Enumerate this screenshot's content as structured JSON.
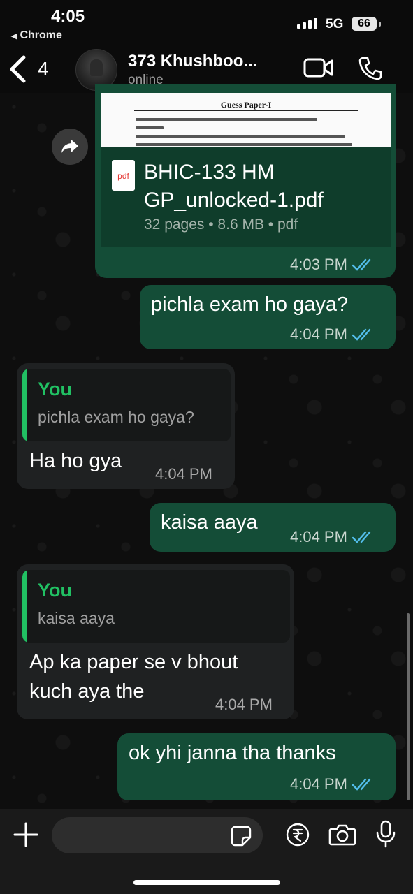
{
  "status_bar": {
    "time": "4:05",
    "back_app": "Chrome",
    "network": "5G",
    "battery": "66"
  },
  "header": {
    "back_count": "4",
    "contact_name": "373 Khushboo...",
    "contact_status": "online"
  },
  "messages": [
    {
      "type": "document",
      "direction": "outgoing",
      "preview_title": "Guess Paper-I",
      "file_name_line1": "BHIC-133 HM",
      "file_name_line2": "GP_unlocked-1.pdf",
      "file_info": "32 pages • 8.6 MB • pdf",
      "file_type_label": "pdf",
      "time": "4:03 PM",
      "status": "read"
    },
    {
      "type": "text",
      "direction": "outgoing",
      "text": "pichla exam ho gaya?",
      "time": "4:04 PM",
      "status": "read"
    },
    {
      "type": "reply",
      "direction": "incoming",
      "reply_author": "You",
      "reply_text": "pichla exam ho gaya?",
      "text": "Ha ho gya",
      "time": "4:04 PM"
    },
    {
      "type": "text",
      "direction": "outgoing",
      "text": "kaisa aaya",
      "time": "4:04 PM",
      "status": "read"
    },
    {
      "type": "reply",
      "direction": "incoming",
      "reply_author": "You",
      "reply_text": "kaisa aaya",
      "text_line1": "Ap ka paper se v bhout",
      "text_line2": "kuch aya the",
      "time": "4:04 PM"
    },
    {
      "type": "text",
      "direction": "outgoing",
      "text": "ok yhi janna tha thanks",
      "time": "4:04 PM",
      "status": "read"
    }
  ],
  "composer": {
    "placeholder": "",
    "value": ""
  },
  "colors": {
    "outgoing_bubble": "#144d37",
    "incoming_bubble": "#1f2122",
    "accent": "#21c063",
    "read_ticks": "#53bdeb"
  },
  "icons": [
    "back-chevron-icon",
    "video-call-icon",
    "phone-icon",
    "forward-icon",
    "pdf-icon",
    "read-ticks-icon",
    "plus-icon",
    "sticker-icon",
    "rupee-icon",
    "camera-icon",
    "mic-icon"
  ]
}
